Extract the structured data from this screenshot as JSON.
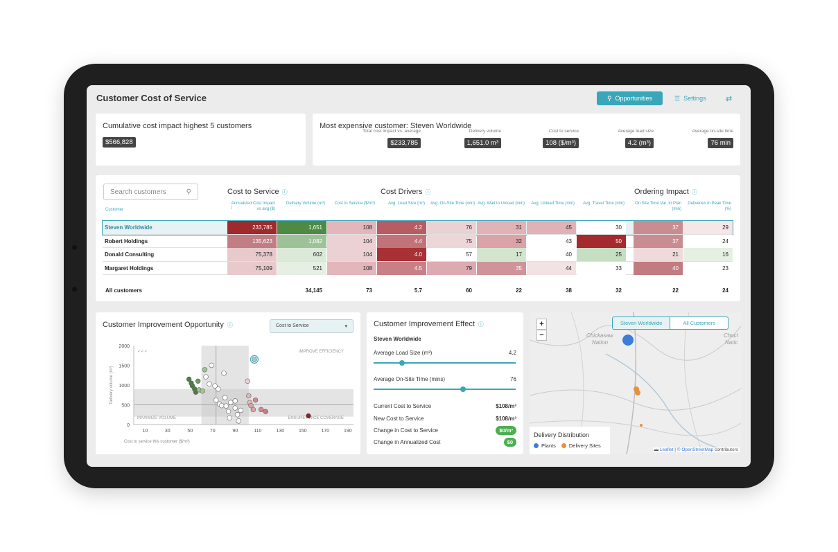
{
  "app_title": "Customer Cost of Service",
  "toolbar": {
    "opportunities": "Opportunities",
    "settings": "Settings"
  },
  "kpi": {
    "title": "Cumulative cost impact highest 5 customers",
    "value": "$566,828"
  },
  "most_expensive": {
    "title": "Most expensive customer: Steven Worldwide",
    "metrics": [
      {
        "label": "Total cost impact vs. average",
        "value": "$233,785"
      },
      {
        "label": "Delivery volume",
        "value": "1,651.0 m³"
      },
      {
        "label": "Cost to service",
        "value": "108 ($/m³)"
      },
      {
        "label": "Average load size",
        "value": "4.2 (m³)"
      },
      {
        "label": "Average on-site time",
        "value": "76 min"
      }
    ]
  },
  "table": {
    "search_placeholder": "Search customers",
    "sections": {
      "cost_to_service": "Cost to Service",
      "cost_drivers": "Cost Drivers",
      "ordering_impact": "Ordering Impact"
    },
    "customer_header": "Customer",
    "columns": [
      "Annualized Cost Impact vs avg ($)",
      "Delivery Volume (m³)",
      "Cost to Service ($/m³)",
      "Avg. Load Size (m³)",
      "Avg. On-Site Time (min)",
      "Avg. Wait to Unload (min)",
      "Avg. Unload Time (min)",
      "Avg. Travel Time (min)",
      "On Site Time Var. to Plan (min)",
      "Deliveries in Peak Time (%)"
    ],
    "rows": [
      {
        "name": "Steven Worldwide",
        "cells": [
          "233,785",
          "1,651",
          "108",
          "4.2",
          "76",
          "31",
          "45",
          "30",
          "37",
          "29"
        ],
        "colors": [
          "#9e2a2b",
          "#4e8a44",
          "#e2b6bb",
          "#b85c63",
          "#ead2d4",
          "#e1b3b7",
          "#e0b1b6",
          "#ffffff",
          "#c98c91",
          "#f5e6e7"
        ]
      },
      {
        "name": "Robert Holdings",
        "cells": [
          "135,623",
          "1,082",
          "104",
          "4.4",
          "75",
          "32",
          "43",
          "50",
          "37",
          "24"
        ],
        "colors": [
          "#c07e84",
          "#9dc297",
          "#ebd1d3",
          "#c27379",
          "#ecd6d8",
          "#d9a3a8",
          "#ffffff",
          "#a52a2e",
          "#c98c91",
          "#ffffff"
        ]
      },
      {
        "name": "Donald Consulting",
        "cells": [
          "75,378",
          "602",
          "104",
          "4.0",
          "57",
          "17",
          "40",
          "25",
          "21",
          "16"
        ],
        "colors": [
          "#e8c9cc",
          "#dbe9d8",
          "#ebd1d3",
          "#a93035",
          "#ffffff",
          "#d3e5cf",
          "#ffffff",
          "#c6dec1",
          "#eed9db",
          "#e5efe2"
        ]
      },
      {
        "name": "Margaret Holdings",
        "cells": [
          "75,109",
          "521",
          "108",
          "4.5",
          "79",
          "35",
          "44",
          "33",
          "40",
          "23"
        ],
        "colors": [
          "#e8c9cc",
          "#e6efe4",
          "#e2b6bb",
          "#c88086",
          "#dcaab0",
          "#cf9499",
          "#f2e2e4",
          "#ffffff",
          "#c27b81",
          "#ffffff"
        ]
      }
    ],
    "totals": {
      "label": "All customers",
      "values": [
        "",
        "34,145",
        "73",
        "5.7",
        "60",
        "22",
        "38",
        "32",
        "22",
        "24"
      ]
    }
  },
  "opportunity": {
    "title": "Customer Improvement Opportunity",
    "dropdown": "Cost to Service",
    "quadrants": {
      "tr": "IMPROVE EFFICIENCY",
      "bl": "MAXIMIZE VOLUME",
      "br": "ENSURE PRICE COVERAGE"
    },
    "ylabel": "Delivery volume (m³)",
    "xlabel": "Cost to service this customer ($/m³)"
  },
  "chart_data": {
    "type": "scatter",
    "xlabel": "Cost to service this customer ($/m³)",
    "ylabel": "Delivery volume (m³)",
    "x_ticks": [
      10,
      30,
      50,
      70,
      90,
      110,
      130,
      150,
      170,
      190
    ],
    "y_ticks": [
      0,
      500,
      1000,
      1500,
      2000
    ],
    "xlim": [
      0,
      195
    ],
    "ylim": [
      0,
      2000
    ],
    "points": [
      {
        "x": 49,
        "y": 1150,
        "c": "#4a7f3f"
      },
      {
        "x": 51,
        "y": 1050,
        "c": "#4a7f3f"
      },
      {
        "x": 52,
        "y": 980,
        "c": "#4a7f3f"
      },
      {
        "x": 54,
        "y": 900,
        "c": "#4a7f3f"
      },
      {
        "x": 55,
        "y": 820,
        "c": "#4a7f3f"
      },
      {
        "x": 57,
        "y": 1100,
        "c": "#6b9d5f"
      },
      {
        "x": 58,
        "y": 880,
        "c": "#9ec494"
      },
      {
        "x": 61,
        "y": 850,
        "c": "#9ec494"
      },
      {
        "x": 63,
        "y": 1390,
        "c": "#9ec494"
      },
      {
        "x": 64,
        "y": 1210,
        "c": "#ffffff"
      },
      {
        "x": 67,
        "y": 1030,
        "c": "#ffffff"
      },
      {
        "x": 69,
        "y": 1500,
        "c": "#ffffff"
      },
      {
        "x": 72,
        "y": 980,
        "c": "#ffffff"
      },
      {
        "x": 75,
        "y": 900,
        "c": "#ffffff"
      },
      {
        "x": 73,
        "y": 620,
        "c": "#ffffff"
      },
      {
        "x": 76,
        "y": 520,
        "c": "#ffffff"
      },
      {
        "x": 78,
        "y": 480,
        "c": "#ffffff"
      },
      {
        "x": 80,
        "y": 1300,
        "c": "#ffffff"
      },
      {
        "x": 81,
        "y": 680,
        "c": "#ffffff"
      },
      {
        "x": 82,
        "y": 470,
        "c": "#ffffff"
      },
      {
        "x": 84,
        "y": 330,
        "c": "#ffffff"
      },
      {
        "x": 85,
        "y": 170,
        "c": "#ffffff"
      },
      {
        "x": 86,
        "y": 560,
        "c": "#ffffff"
      },
      {
        "x": 90,
        "y": 600,
        "c": "#ffffff"
      },
      {
        "x": 90,
        "y": 420,
        "c": "#ffffff"
      },
      {
        "x": 92,
        "y": 250,
        "c": "#ffffff"
      },
      {
        "x": 93,
        "y": 90,
        "c": "#ffffff"
      },
      {
        "x": 95,
        "y": 360,
        "c": "#ffffff"
      },
      {
        "x": 101,
        "y": 1100,
        "c": "#ead2d4"
      },
      {
        "x": 102,
        "y": 730,
        "c": "#e2b6bb"
      },
      {
        "x": 103,
        "y": 560,
        "c": "#e2b6bb"
      },
      {
        "x": 104,
        "y": 480,
        "c": "#d9a3a8"
      },
      {
        "x": 106,
        "y": 380,
        "c": "#d9a3a8"
      },
      {
        "x": 108,
        "y": 620,
        "c": "#c98c91"
      },
      {
        "x": 107,
        "y": 1651,
        "c": "#9ec6cf",
        "selected": true
      },
      {
        "x": 113,
        "y": 380,
        "c": "#c98c91"
      },
      {
        "x": 117,
        "y": 330,
        "c": "#c07e84"
      },
      {
        "x": 155,
        "y": 220,
        "c": "#8a1f25"
      }
    ]
  },
  "effect": {
    "title": "Customer Improvement Effect",
    "customer": "Steven Worldwide",
    "load": {
      "label": "Average Load Size (m³)",
      "value": "4.2",
      "fraction": 0.2
    },
    "onsite": {
      "label": "Average On-Site Time (mins)",
      "value": "76",
      "fraction": 0.63
    },
    "rows": [
      {
        "label": "Current Cost to Service",
        "value": "$108/m³"
      },
      {
        "label": "New Cost to Service",
        "value": "$108/m³"
      },
      {
        "label": "Change in Cost to Service",
        "value": "$0/m³"
      },
      {
        "label": "Change in Annualized Cost",
        "value": "$0"
      }
    ]
  },
  "map": {
    "toggle": [
      "Steven Worldwide",
      "All Customers"
    ],
    "labels": [
      "Chickasaw",
      "Nation",
      "Choct",
      "Natic"
    ],
    "legend_title": "Delivery Distribution",
    "legend": [
      "Plants",
      "Delivery Sites"
    ],
    "attribution_leaflet": "Leaflet",
    "attribution_osm": "© OpenStreetMap",
    "attribution_contrib": "contributors",
    "colors": {
      "plants": "#3b7dd8",
      "sites": "#e8903a"
    }
  },
  "colors": {
    "accent": "#3aa6b9"
  }
}
